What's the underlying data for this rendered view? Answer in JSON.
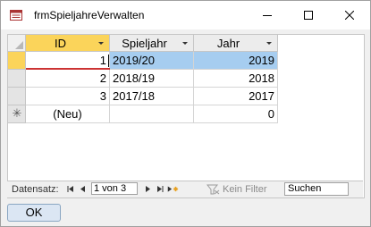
{
  "window": {
    "title": "frmSpieljahreVerwalten"
  },
  "datasheet": {
    "columns": [
      {
        "label": "ID"
      },
      {
        "label": "Spieljahr"
      },
      {
        "label": "Jahr"
      }
    ],
    "rows": [
      {
        "id": "1",
        "spieljahr": "2019/20",
        "jahr": "2019"
      },
      {
        "id": "2",
        "spieljahr": "2018/19",
        "jahr": "2018"
      },
      {
        "id": "3",
        "spieljahr": "2017/18",
        "jahr": "2017"
      }
    ],
    "new_row": {
      "id": "(Neu)",
      "spieljahr": "",
      "jahr": "0",
      "selector": "✳"
    }
  },
  "navigation": {
    "label": "Datensatz:",
    "position": "1 von 3",
    "no_filter": "Kein Filter",
    "search": "Suchen"
  },
  "ok_button": {
    "label": "OK"
  }
}
